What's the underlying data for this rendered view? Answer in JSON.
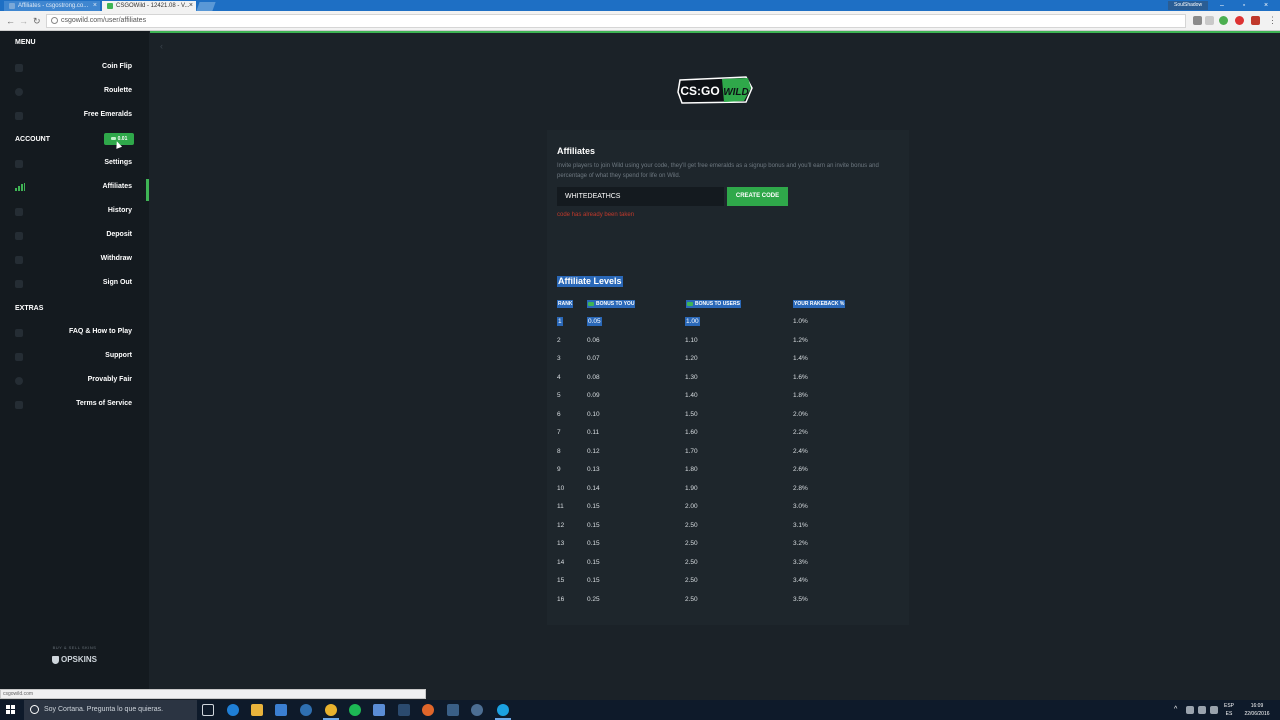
{
  "browser": {
    "tabs": [
      {
        "title": "Affiliates - csgostrong.co...",
        "active": false
      },
      {
        "title": "CSGOWild - 12421.08 - V...",
        "active": true
      }
    ],
    "profile": "SoulShadow",
    "url": "csgowild.com/user/affiliates"
  },
  "sidebar": {
    "menu_heading": "MENU",
    "menu_items": [
      {
        "label": "Coin Flip",
        "icon": "coin-icon"
      },
      {
        "label": "Roulette",
        "icon": "roulette-icon"
      },
      {
        "label": "Free Emeralds",
        "icon": "emerald-icon"
      }
    ],
    "account_heading": "ACCOUNT",
    "balance": "0.01",
    "account_items": [
      {
        "label": "Settings",
        "icon": "user-icon"
      },
      {
        "label": "Affiliates",
        "icon": "signal-icon",
        "active": true
      },
      {
        "label": "History",
        "icon": "bookmark-icon"
      },
      {
        "label": "Deposit",
        "icon": "deposit-icon"
      },
      {
        "label": "Withdraw",
        "icon": "withdraw-icon"
      },
      {
        "label": "Sign Out",
        "icon": "signout-icon"
      }
    ],
    "extras_heading": "EXTRAS",
    "extras_items": [
      {
        "label": "FAQ & How to Play",
        "icon": "info-icon"
      },
      {
        "label": "Support",
        "icon": "chat-icon"
      },
      {
        "label": "Provably Fair",
        "icon": "fair-icon"
      },
      {
        "label": "Terms of Service",
        "icon": "document-icon"
      }
    ],
    "sponsor_small": "BUY & SELL SKINS",
    "sponsor": "OPSKINS"
  },
  "logo_text": "CS:GO WILD",
  "affiliates": {
    "title": "Affiliates",
    "description": "Invite players to join Wild using your code, they'll get free emeralds as a signup bonus and you'll earn an invite bonus and percentage of what they spend for life on Wild.",
    "code_value": "WHITEDEATHCS",
    "create_button": "CREATE CODE",
    "error": "code has already been taken"
  },
  "levels": {
    "title": "Affiliate Levels",
    "headers": [
      "RANK",
      "BONUS TO YOU",
      "BONUS TO USERS",
      "YOUR RAKEBACK %"
    ],
    "rows": [
      [
        "1",
        "0.05",
        "1.00",
        "1.0%"
      ],
      [
        "2",
        "0.06",
        "1.10",
        "1.2%"
      ],
      [
        "3",
        "0.07",
        "1.20",
        "1.4%"
      ],
      [
        "4",
        "0.08",
        "1.30",
        "1.6%"
      ],
      [
        "5",
        "0.09",
        "1.40",
        "1.8%"
      ],
      [
        "6",
        "0.10",
        "1.50",
        "2.0%"
      ],
      [
        "7",
        "0.11",
        "1.60",
        "2.2%"
      ],
      [
        "8",
        "0.12",
        "1.70",
        "2.4%"
      ],
      [
        "9",
        "0.13",
        "1.80",
        "2.6%"
      ],
      [
        "10",
        "0.14",
        "1.90",
        "2.8%"
      ],
      [
        "11",
        "0.15",
        "2.00",
        "3.0%"
      ],
      [
        "12",
        "0.15",
        "2.50",
        "3.1%"
      ],
      [
        "13",
        "0.15",
        "2.50",
        "3.2%"
      ],
      [
        "14",
        "0.15",
        "2.50",
        "3.3%"
      ],
      [
        "15",
        "0.15",
        "2.50",
        "3.4%"
      ],
      [
        "16",
        "0.25",
        "2.50",
        "3.5%"
      ]
    ]
  },
  "status_url": "csgowild.com",
  "taskbar": {
    "cortana": "Soy Cortana. Pregunta lo que quieras.",
    "lang": "ESP",
    "lang2": "ES",
    "time": "16:09",
    "date": "22/06/2016"
  },
  "colors": {
    "accent": "#3fb455",
    "selection": "#2a68b8",
    "error": "#c0392b"
  }
}
